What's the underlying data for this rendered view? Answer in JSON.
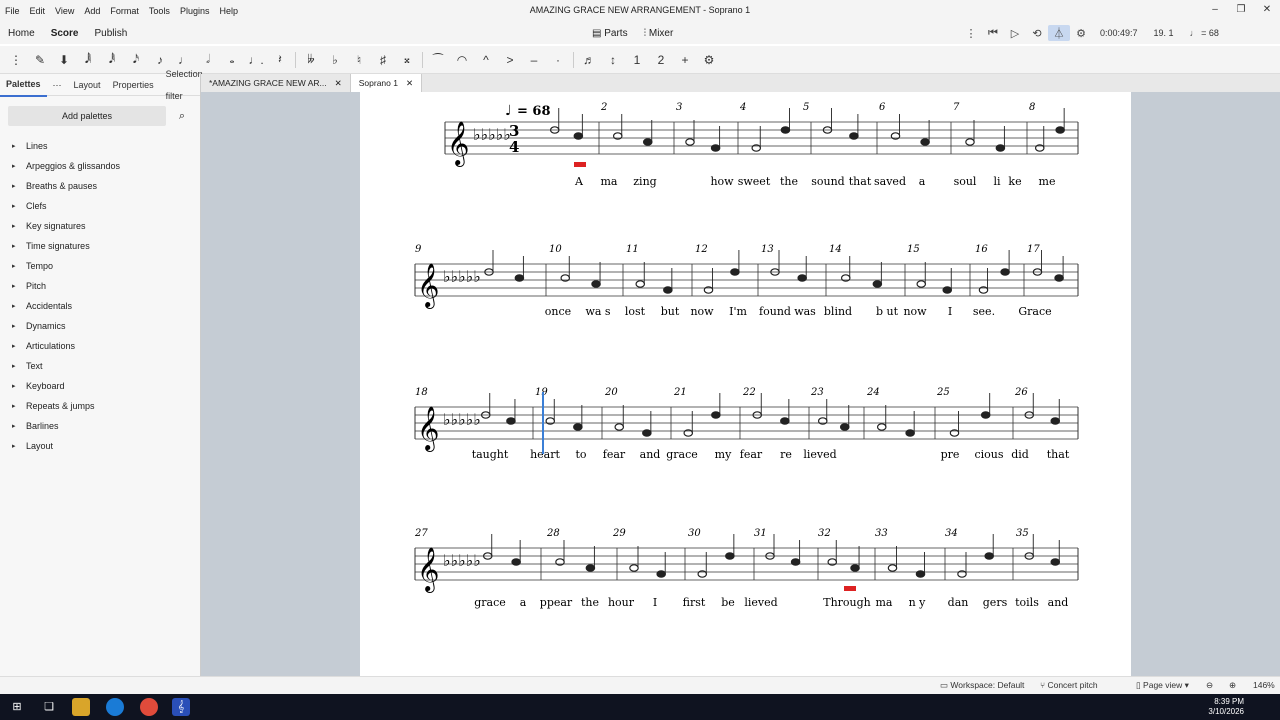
{
  "window": {
    "title": "AMAZING GRACE NEW ARRANGEMENT - Soprano 1"
  },
  "menu": [
    "File",
    "Edit",
    "View",
    "Add",
    "Format",
    "Tools",
    "Plugins",
    "Help"
  ],
  "nav": {
    "tabs": [
      "Home",
      "Score",
      "Publish"
    ],
    "active": "Score",
    "parts": "Parts",
    "mixer": "Mixer",
    "time": "0:00:49:7",
    "position": "19. 1",
    "tempo": "= 68"
  },
  "palettes": {
    "tabs": [
      "Palettes",
      "Layout",
      "Properties",
      "Selection filter"
    ],
    "add_button": "Add palettes",
    "items": [
      "Lines",
      "Arpeggios & glissandos",
      "Breaths & pauses",
      "Clefs",
      "Key signatures",
      "Time signatures",
      "Tempo",
      "Pitch",
      "Accidentals",
      "Dynamics",
      "Articulations",
      "Text",
      "Keyboard",
      "Repeats & jumps",
      "Barlines",
      "Layout"
    ]
  },
  "doc_tabs": [
    "*AMAZING GRACE NEW AR...",
    "Soprano 1"
  ],
  "score": {
    "tempo_mark": "= 68",
    "time_sig": [
      "3",
      "4"
    ],
    "systems": [
      {
        "measures": [
          "2",
          "3",
          "4",
          "5",
          "6",
          "7",
          "8"
        ],
        "lyrics": [
          "A",
          "ma",
          "zing",
          "how",
          "sweet",
          "the",
          "sound",
          "that",
          "saved",
          "a",
          "soul",
          "li",
          "ke",
          "me"
        ]
      },
      {
        "measures": [
          "9",
          "10",
          "11",
          "12",
          "13",
          "14",
          "15",
          "16",
          "17"
        ],
        "lyrics": [
          "once",
          "wa s",
          "lost",
          "but",
          "now",
          "I'm",
          "found",
          "was",
          "blind",
          "b ut",
          "now",
          "I",
          "see.",
          "Grace"
        ]
      },
      {
        "measures": [
          "18",
          "19",
          "20",
          "21",
          "22",
          "23",
          "24",
          "25",
          "26"
        ],
        "lyrics": [
          "taught",
          "heart",
          "to",
          "fear",
          "and",
          "grace",
          "my",
          "fear",
          "re",
          "lieved",
          "pre",
          "cious",
          "did",
          "that"
        ]
      },
      {
        "measures": [
          "27",
          "28",
          "29",
          "30",
          "31",
          "32",
          "33",
          "34",
          "35"
        ],
        "lyrics": [
          "grace",
          "a",
          "ppear",
          "the",
          "hour",
          "I",
          "first",
          "be",
          "lieved",
          "Through",
          "ma",
          "n y",
          "dan",
          "gers",
          "toils",
          "and"
        ]
      }
    ]
  },
  "status": {
    "workspace": "Workspace: Default",
    "concert": "Concert pitch",
    "view": "Page view",
    "zoom": "146%"
  },
  "clock": {
    "time": "8:39 PM",
    "date": "3/10/2026"
  }
}
